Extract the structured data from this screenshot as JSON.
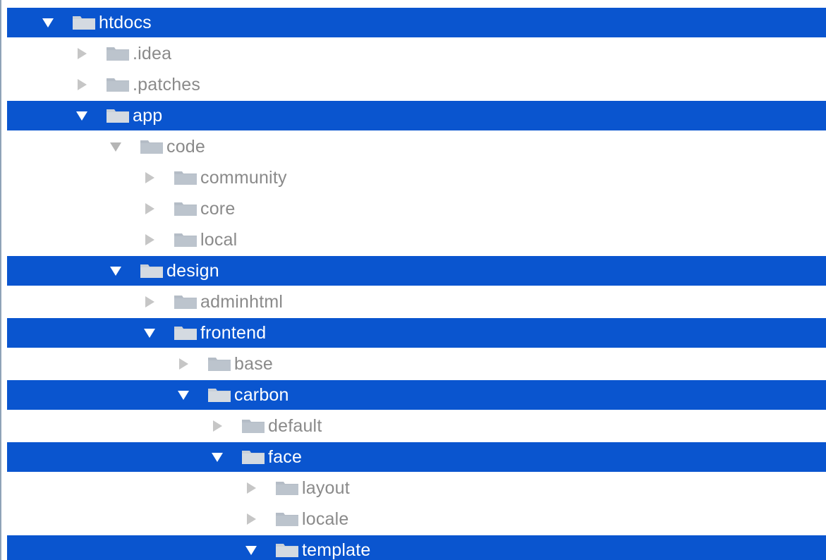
{
  "tree": {
    "nodes": [
      {
        "label": "htdocs",
        "depth": 0,
        "expanded": true,
        "selected": true,
        "icon": "folder-icon"
      },
      {
        "label": ".idea",
        "depth": 1,
        "expanded": false,
        "selected": false,
        "icon": "folder-icon"
      },
      {
        "label": ".patches",
        "depth": 1,
        "expanded": false,
        "selected": false,
        "icon": "folder-icon"
      },
      {
        "label": "app",
        "depth": 1,
        "expanded": true,
        "selected": true,
        "icon": "folder-icon"
      },
      {
        "label": "code",
        "depth": 2,
        "expanded": true,
        "selected": false,
        "icon": "folder-icon"
      },
      {
        "label": "community",
        "depth": 3,
        "expanded": false,
        "selected": false,
        "icon": "folder-icon"
      },
      {
        "label": "core",
        "depth": 3,
        "expanded": false,
        "selected": false,
        "icon": "folder-icon"
      },
      {
        "label": "local",
        "depth": 3,
        "expanded": false,
        "selected": false,
        "icon": "folder-icon"
      },
      {
        "label": "design",
        "depth": 2,
        "expanded": true,
        "selected": true,
        "icon": "folder-icon"
      },
      {
        "label": "adminhtml",
        "depth": 3,
        "expanded": false,
        "selected": false,
        "icon": "folder-icon"
      },
      {
        "label": "frontend",
        "depth": 3,
        "expanded": true,
        "selected": true,
        "icon": "folder-icon"
      },
      {
        "label": "base",
        "depth": 4,
        "expanded": false,
        "selected": false,
        "icon": "folder-icon"
      },
      {
        "label": "carbon",
        "depth": 4,
        "expanded": true,
        "selected": true,
        "icon": "folder-icon"
      },
      {
        "label": "default",
        "depth": 5,
        "expanded": false,
        "selected": false,
        "icon": "folder-icon"
      },
      {
        "label": "face",
        "depth": 5,
        "expanded": true,
        "selected": true,
        "icon": "folder-icon"
      },
      {
        "label": "layout",
        "depth": 6,
        "expanded": false,
        "selected": false,
        "icon": "folder-icon"
      },
      {
        "label": "locale",
        "depth": 6,
        "expanded": false,
        "selected": false,
        "icon": "folder-icon"
      },
      {
        "label": "template",
        "depth": 6,
        "expanded": true,
        "selected": true,
        "icon": "folder-icon"
      }
    ]
  },
  "colors": {
    "selection": "#0a55cf",
    "text": "#8a8a8a",
    "selected_text": "#ffffff",
    "folder": "#b4bcc6",
    "folder_selected": "#c9d0d8"
  }
}
